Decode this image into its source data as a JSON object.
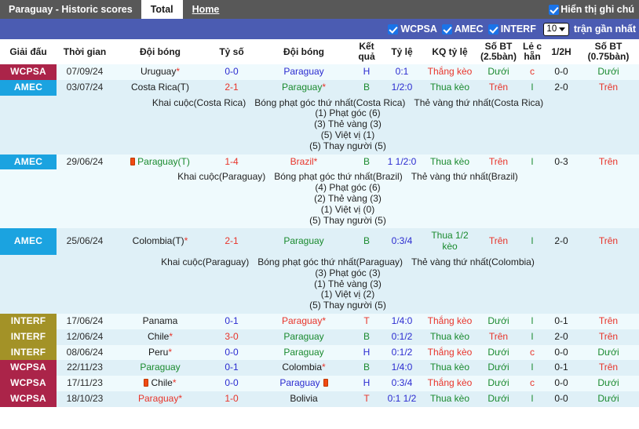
{
  "topbar": {
    "title": "Paraguay - Historic scores",
    "tab_total": "Total",
    "tab_home": "Home",
    "show_notes_label": "Hiển thị ghi chú",
    "show_notes_checked": true,
    "icon_checkbox": "checkbox-checked-icon"
  },
  "filterbar": {
    "filters": [
      {
        "label": "WCPSA",
        "checked": true
      },
      {
        "label": "AMEC",
        "checked": true
      },
      {
        "label": "INTERF",
        "checked": true
      }
    ],
    "count_value": "10",
    "count_caret": "chevron-down-icon",
    "recent_label": "trận gần nhất",
    "bar_color": "#4b5cb2"
  },
  "table": {
    "headers": [
      "Giải đấu",
      "Thời gian",
      "Đội bóng",
      "Tỷ số",
      "Đội bóng",
      "Kết quả",
      "Tỷ lệ",
      "KQ tỷ lệ",
      "Số BT (2.5bàn)",
      "Lẻ c hẵn",
      "1/2H",
      "Số BT (0.75bàn)"
    ],
    "league_colors": {
      "WCPSA": "#ab2449",
      "AMEC": "#1ba3e0",
      "INTERF": "#a39227"
    },
    "rows": [
      {
        "league": "WCPSA",
        "date": "07/09/24",
        "home": "Uruguay",
        "home_star": true,
        "home_card": false,
        "score": "0-0",
        "away": "Paraguay",
        "away_star": false,
        "away_card": false,
        "result": "H",
        "odds": "0:1",
        "kq_odds": "Thắng kèo",
        "bt25": "Dưới",
        "oddeven": "c",
        "half": "0-0",
        "bt075": "Dưới",
        "note": null
      },
      {
        "league": "AMEC",
        "date": "03/07/24",
        "home": "Costa Rica(T)",
        "home_star": false,
        "home_card": false,
        "score": "2-1",
        "away": "Paraguay",
        "away_star": true,
        "away_card": false,
        "result": "B",
        "odds": "1/2:0",
        "kq_odds": "Thua kèo",
        "bt25": "Trên",
        "oddeven": "l",
        "half": "2-0",
        "bt075": "Trên",
        "note": {
          "head": [
            "Khai cuộc(Costa Rica)",
            "Bóng phạt góc thứ nhất(Costa Rica)",
            "Thẻ vàng thứ nhất(Costa Rica)"
          ],
          "lines": [
            "(1) Phạt góc (6)",
            "(3) Thẻ vàng (3)",
            "(5) Việt vị (1)",
            "(5) Thay người (5)"
          ]
        }
      },
      {
        "league": "AMEC",
        "date": "29/06/24",
        "home": "Paraguay(T)",
        "home_star": false,
        "home_card": true,
        "score": "1-4",
        "away": "Brazil",
        "away_star": true,
        "away_card": false,
        "result": "B",
        "odds": "1 1/2:0",
        "kq_odds": "Thua kèo",
        "bt25": "Trên",
        "oddeven": "l",
        "half": "0-3",
        "bt075": "Trên",
        "note": {
          "head": [
            "Khai cuộc(Paraguay)",
            "Bóng phạt góc thứ nhất(Brazil)",
            "Thẻ vàng thứ nhất(Brazil)"
          ],
          "lines": [
            "(4) Phạt góc (6)",
            "(2) Thẻ vàng (3)",
            "(1) Việt vị (0)",
            "(5) Thay người (5)"
          ]
        }
      },
      {
        "league": "AMEC",
        "date": "25/06/24",
        "home": "Colombia(T)",
        "home_star": true,
        "home_card": false,
        "score": "2-1",
        "away": "Paraguay",
        "away_star": false,
        "away_card": false,
        "result": "B",
        "odds": "0:3/4",
        "kq_odds": "Thua 1/2 kèo",
        "bt25": "Trên",
        "oddeven": "l",
        "half": "2-0",
        "bt075": "Trên",
        "note": {
          "head": [
            "Khai cuộc(Paraguay)",
            "Bóng phạt góc thứ nhất(Paraguay)",
            "Thẻ vàng thứ nhất(Colombia)"
          ],
          "lines": [
            "(3) Phạt góc (3)",
            "(1) Thẻ vàng (3)",
            "(1) Việt vị (2)",
            "(5) Thay người (5)"
          ]
        }
      },
      {
        "league": "INTERF",
        "date": "17/06/24",
        "home": "Panama",
        "home_star": false,
        "home_card": false,
        "score": "0-1",
        "away": "Paraguay",
        "away_star": true,
        "away_card": false,
        "result": "T",
        "odds": "1/4:0",
        "kq_odds": "Thắng kèo",
        "bt25": "Dưới",
        "oddeven": "l",
        "half": "0-1",
        "bt075": "Trên",
        "note": null
      },
      {
        "league": "INTERF",
        "date": "12/06/24",
        "home": "Chile",
        "home_star": true,
        "home_card": false,
        "score": "3-0",
        "away": "Paraguay",
        "away_star": false,
        "away_card": false,
        "result": "B",
        "odds": "0:1/2",
        "kq_odds": "Thua kèo",
        "bt25": "Trên",
        "oddeven": "l",
        "half": "2-0",
        "bt075": "Trên",
        "note": null
      },
      {
        "league": "INTERF",
        "date": "08/06/24",
        "home": "Peru",
        "home_star": true,
        "home_card": false,
        "score": "0-0",
        "away": "Paraguay",
        "away_star": false,
        "away_card": false,
        "result": "H",
        "odds": "0:1/2",
        "kq_odds": "Thắng kèo",
        "bt25": "Dưới",
        "oddeven": "c",
        "half": "0-0",
        "bt075": "Dưới",
        "note": null
      },
      {
        "league": "WCPSA",
        "date": "22/11/23",
        "home": "Paraguay",
        "home_star": false,
        "home_card": false,
        "score": "0-1",
        "away": "Colombia",
        "away_star": true,
        "away_card": false,
        "result": "B",
        "odds": "1/4:0",
        "kq_odds": "Thua kèo",
        "bt25": "Dưới",
        "oddeven": "l",
        "half": "0-1",
        "bt075": "Trên",
        "note": null
      },
      {
        "league": "WCPSA",
        "date": "17/11/23",
        "home": "Chile",
        "home_star": true,
        "home_card": true,
        "score": "0-0",
        "away": "Paraguay",
        "away_star": false,
        "away_card": true,
        "result": "H",
        "odds": "0:3/4",
        "kq_odds": "Thắng kèo",
        "bt25": "Dưới",
        "oddeven": "c",
        "half": "0-0",
        "bt075": "Dưới",
        "note": null
      },
      {
        "league": "WCPSA",
        "date": "18/10/23",
        "home": "Paraguay",
        "home_star": true,
        "home_card": false,
        "score": "1-0",
        "away": "Bolivia",
        "away_star": false,
        "away_card": false,
        "result": "T",
        "odds": "0:1 1/2",
        "kq_odds": "Thua kèo",
        "bt25": "Dưới",
        "oddeven": "l",
        "half": "0-0",
        "bt075": "Dưới",
        "note": null
      }
    ]
  }
}
